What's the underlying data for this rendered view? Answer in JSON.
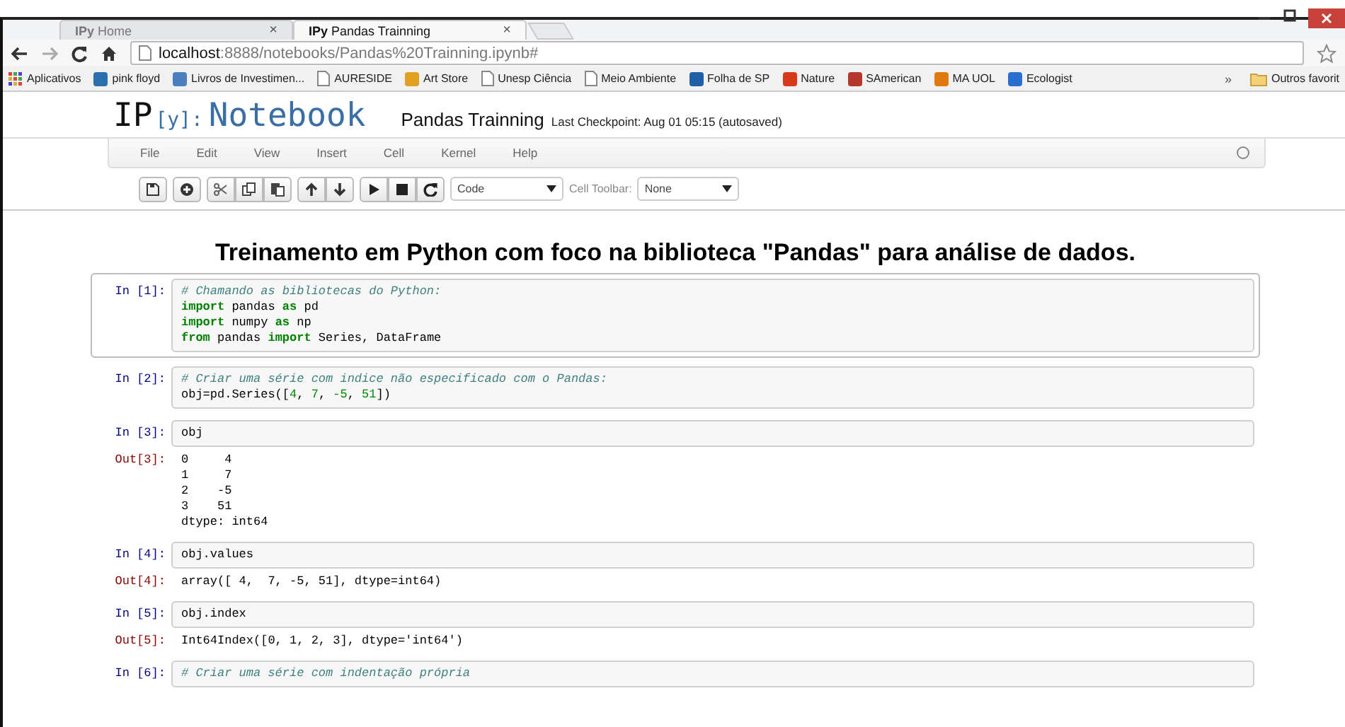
{
  "browser": {
    "tabs": [
      {
        "label": "**IPy** Home",
        "selected": false,
        "close": "×"
      },
      {
        "label": "**IPy** Pandas Trainning",
        "selected": true,
        "close": "×"
      }
    ],
    "address": {
      "host": "localhost",
      "rest": ":8888/notebooks/Pandas%20Trainning.ipynb#"
    },
    "bookmarks": [
      {
        "kind": "apps",
        "label": "Aplicativos"
      },
      {
        "kind": "favicon",
        "color": "#2a6fb0",
        "label": "pink floyd"
      },
      {
        "kind": "favicon",
        "color": "#4a7fc0",
        "label": "Livros de Investimen..."
      },
      {
        "kind": "page",
        "label": "AURESIDE"
      },
      {
        "kind": "favicon",
        "color": "#e0a020",
        "label": "Art Store"
      },
      {
        "kind": "page",
        "label": "Unesp Ciência"
      },
      {
        "kind": "page",
        "label": "Meio Ambiente"
      },
      {
        "kind": "favicon",
        "color": "#1f5fa8",
        "label": "Folha de SP"
      },
      {
        "kind": "favicon",
        "color": "#d63a1a",
        "label": "Nature"
      },
      {
        "kind": "favicon",
        "color": "#b3372c",
        "label": "SAmerican"
      },
      {
        "kind": "favicon",
        "color": "#e07a10",
        "label": "MA UOL"
      },
      {
        "kind": "favicon",
        "color": "#2a6fd0",
        "label": "Ecologist"
      }
    ],
    "overflow": "»",
    "other_bookmarks": "Outros favorit"
  },
  "notebook": {
    "logo_ip": "IP",
    "logo_y": "[y]:",
    "logo_name": "Notebook",
    "title": "Pandas Trainning",
    "checkpoint": "Last Checkpoint: Aug 01 05:15 (autosaved)"
  },
  "menu": [
    "File",
    "Edit",
    "View",
    "Insert",
    "Cell",
    "Kernel",
    "Help"
  ],
  "toolbar": {
    "groups": [
      [
        {
          "kind": "save"
        }
      ],
      [
        {
          "kind": "add"
        }
      ],
      [
        {
          "kind": "cut"
        },
        {
          "kind": "copy"
        },
        {
          "kind": "paste"
        }
      ],
      [
        {
          "kind": "up"
        },
        {
          "kind": "down"
        }
      ],
      [
        {
          "kind": "run"
        },
        {
          "kind": "stop"
        },
        {
          "kind": "restart"
        }
      ]
    ],
    "cell_type": "Code",
    "cell_toolbar_label": "Cell Toolbar:",
    "cell_toolbar": "None"
  },
  "cells": [
    {
      "kind": "heading",
      "text": "Treinamento em Python com foco na biblioteca \"Pandas\" para análise de dados."
    },
    {
      "kind": "code",
      "selected": true,
      "prompt": "In [1]:",
      "lines": [
        [
          {
            "kind": "comment",
            "text": "# Chamando as bibliotecas do Python:"
          }
        ],
        [
          {
            "kind": "keyword",
            "text": "import"
          },
          {
            "kind": "plain",
            "text": " pandas "
          },
          {
            "kind": "keyword",
            "text": "as"
          },
          {
            "kind": "plain",
            "text": " pd"
          }
        ],
        [
          {
            "kind": "keyword",
            "text": "import"
          },
          {
            "kind": "plain",
            "text": " numpy "
          },
          {
            "kind": "keyword",
            "text": "as"
          },
          {
            "kind": "plain",
            "text": " np"
          }
        ],
        [
          {
            "kind": "keyword",
            "text": "from"
          },
          {
            "kind": "plain",
            "text": " pandas "
          },
          {
            "kind": "keyword",
            "text": "import"
          },
          {
            "kind": "plain",
            "text": " Series, DataFrame"
          }
        ]
      ]
    },
    {
      "kind": "code",
      "selected": false,
      "prompt": "In [2]:",
      "lines": [
        [
          {
            "kind": "comment",
            "text": "# Criar uma série com indice não especificado com o Pandas:"
          }
        ],
        [
          {
            "kind": "plain",
            "text": "obj=pd.Series(["
          },
          {
            "kind": "number",
            "text": "4"
          },
          {
            "kind": "plain",
            "text": ", "
          },
          {
            "kind": "number",
            "text": "7"
          },
          {
            "kind": "plain",
            "text": ", "
          },
          {
            "kind": "number",
            "text": "-5"
          },
          {
            "kind": "plain",
            "text": ", "
          },
          {
            "kind": "number",
            "text": "51"
          },
          {
            "kind": "plain",
            "text": "])"
          }
        ]
      ]
    },
    {
      "kind": "code",
      "selected": false,
      "prompt": "In [3]:",
      "lines": [
        [
          {
            "kind": "plain",
            "text": "obj"
          }
        ]
      ],
      "output": {
        "prompt": "Out[3]:",
        "lines": [
          "0     4",
          "1     7",
          "2    -5",
          "3    51",
          "dtype: int64"
        ]
      }
    },
    {
      "kind": "code",
      "selected": false,
      "prompt": "In [4]:",
      "lines": [
        [
          {
            "kind": "plain",
            "text": "obj.values"
          }
        ]
      ],
      "output": {
        "prompt": "Out[4]:",
        "lines": [
          "array([ 4,  7, -5, 51], dtype=int64)"
        ]
      }
    },
    {
      "kind": "code",
      "selected": false,
      "prompt": "In [5]:",
      "lines": [
        [
          {
            "kind": "plain",
            "text": "obj.index"
          }
        ]
      ],
      "output": {
        "prompt": "Out[5]:",
        "lines": [
          "Int64Index([0, 1, 2, 3], dtype='int64')"
        ]
      }
    },
    {
      "kind": "code",
      "selected": false,
      "prompt": "In [6]:",
      "lines": [
        [
          {
            "kind": "comment",
            "text": "# Criar uma série com indentação própria"
          }
        ]
      ]
    }
  ]
}
